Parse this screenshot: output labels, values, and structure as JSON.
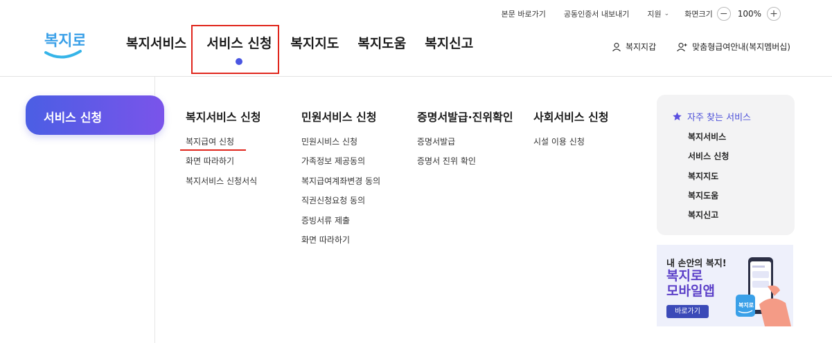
{
  "utility": {
    "skip": "본문 바로가기",
    "cert": "공동인증서 내보내기",
    "lang": "지원",
    "zoom_label": "화면크기",
    "zoom_value": "100%"
  },
  "logo": {
    "text": "복지로"
  },
  "gnb": [
    "복지서비스",
    "서비스 신청",
    "복지지도",
    "복지도움",
    "복지신고"
  ],
  "header_right": {
    "wallet": "복지지갑",
    "membership": "맞춤형급여안내(복지멤버십)"
  },
  "side": {
    "title": "서비스 신청"
  },
  "columns": [
    {
      "title": "복지서비스 신청",
      "items": [
        "복지급여 신청",
        "화면 따라하기",
        "복지서비스 신청서식"
      ]
    },
    {
      "title": "민원서비스 신청",
      "items": [
        "민원시비스 신청",
        "가족정보 제공동의",
        "복지급여계좌변경 동의",
        "직권신청요청 동의",
        "증빙서류 제출",
        "화면 따라하기"
      ]
    },
    {
      "title": "증명서발급·진위확인",
      "items": [
        "증명서발급",
        "증명서 진위 확인"
      ]
    },
    {
      "title": "사회서비스 신청",
      "items": [
        "시설 이용 신청"
      ]
    }
  ],
  "frequent": {
    "title": "자주 찾는 서비스",
    "items": [
      "복지서비스",
      "서비스 신청",
      "복지지도",
      "복지도움",
      "복지신고"
    ]
  },
  "banner": {
    "line1": "내 손안의 복지!",
    "line2": "복지로",
    "line3": "모바일앱",
    "button": "바로가기"
  },
  "colors": {
    "accent": "#4b5ee4",
    "highlight": "#e0251b"
  }
}
